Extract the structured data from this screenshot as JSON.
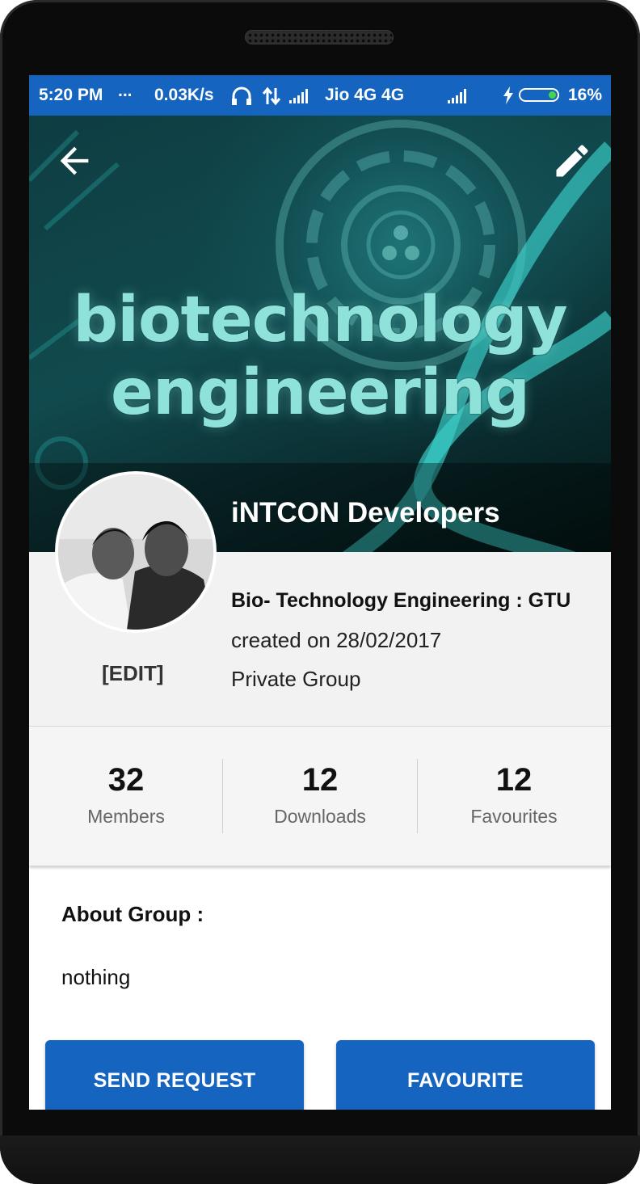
{
  "status_bar": {
    "time": "5:20 PM",
    "dots": "...",
    "speed": "0.03K/s",
    "carrier": "Jio 4G 4G",
    "battery_percent": "16%",
    "battery_level": 0.16,
    "icons": [
      "headset-icon",
      "data-arrows-icon",
      "signal-icon",
      "charging-icon",
      "battery-icon"
    ]
  },
  "header": {
    "back_icon": "arrow-back-icon",
    "edit_icon": "pencil-icon",
    "group_name": "iNTCON Developers",
    "cover_text": [
      "biotechnology",
      "engineering"
    ]
  },
  "profile": {
    "edit_label": "[EDIT]",
    "title": "Bio- Technology Engineering : GTU",
    "created": "created on 28/02/2017",
    "type": "Private Group"
  },
  "stats": [
    {
      "value": "32",
      "label": "Members"
    },
    {
      "value": "12",
      "label": "Downloads"
    },
    {
      "value": "12",
      "label": "Favourites"
    }
  ],
  "about": {
    "label": "About Group :",
    "text": "nothing"
  },
  "actions": {
    "send_request": "SEND REQUEST",
    "favourite": "FAVOURITE"
  },
  "colors": {
    "primary": "#1565c0",
    "cover_teal": "#114a4e",
    "cover_text": "#8fe2da"
  }
}
